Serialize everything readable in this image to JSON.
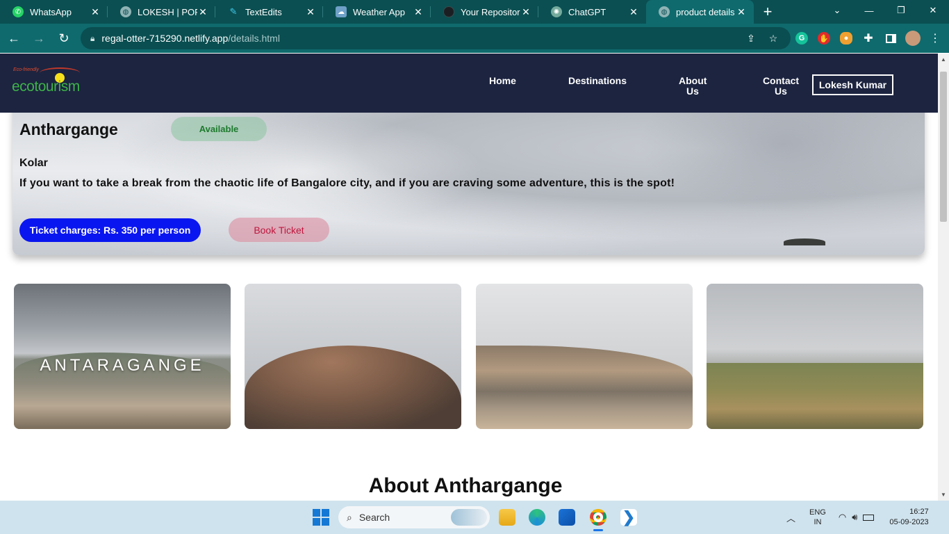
{
  "browser": {
    "tabs": [
      {
        "label": "WhatsApp",
        "icon": "whatsapp-icon",
        "color": "#25d366"
      },
      {
        "label": "LOKESH | PORTFO",
        "icon": "globe-icon",
        "color": "#8fb3b5"
      },
      {
        "label": "TextEdits",
        "icon": "pen-icon",
        "color": "#3fc8e8"
      },
      {
        "label": "Weather App",
        "icon": "weather-icon",
        "color": "#6fa0c8"
      },
      {
        "label": "Your Repositories",
        "icon": "github-icon",
        "color": "#1b1f23"
      },
      {
        "label": "ChatGPT",
        "icon": "chatgpt-icon",
        "color": "#74aa9c"
      },
      {
        "label": "product details",
        "icon": "globe-icon",
        "color": "#8fb3b5"
      }
    ],
    "close_glyph": "✕",
    "new_tab_glyph": "+",
    "url_host": "regal-otter-715290.netlify.app",
    "url_path": "/details.html"
  },
  "site": {
    "logo_small": "Eco-friendly",
    "logo_text": "ecotourism",
    "nav": {
      "home": "Home",
      "destinations": "Destinations",
      "about_line1": "About",
      "about_line2": "Us",
      "contact_line1": "Contact",
      "contact_line2": "Us"
    },
    "user": "Lokesh Kumar"
  },
  "product": {
    "name": "Anthargange",
    "status": "Available",
    "region": "Kolar",
    "description": "If you want to take a break from the chaotic life of Bangalore city, and if you are craving some adventure, this is the spot!",
    "price": "Ticket charges: Rs. 350 per person",
    "book_label": "Book Ticket"
  },
  "gallery": {
    "caption_first": "ANTARAGANGE"
  },
  "about_heading": "About Anthargange",
  "taskbar": {
    "search_placeholder": "Search",
    "lang_top": "ENG",
    "lang_bottom": "IN",
    "time": "16:27",
    "date": "05-09-2023"
  }
}
